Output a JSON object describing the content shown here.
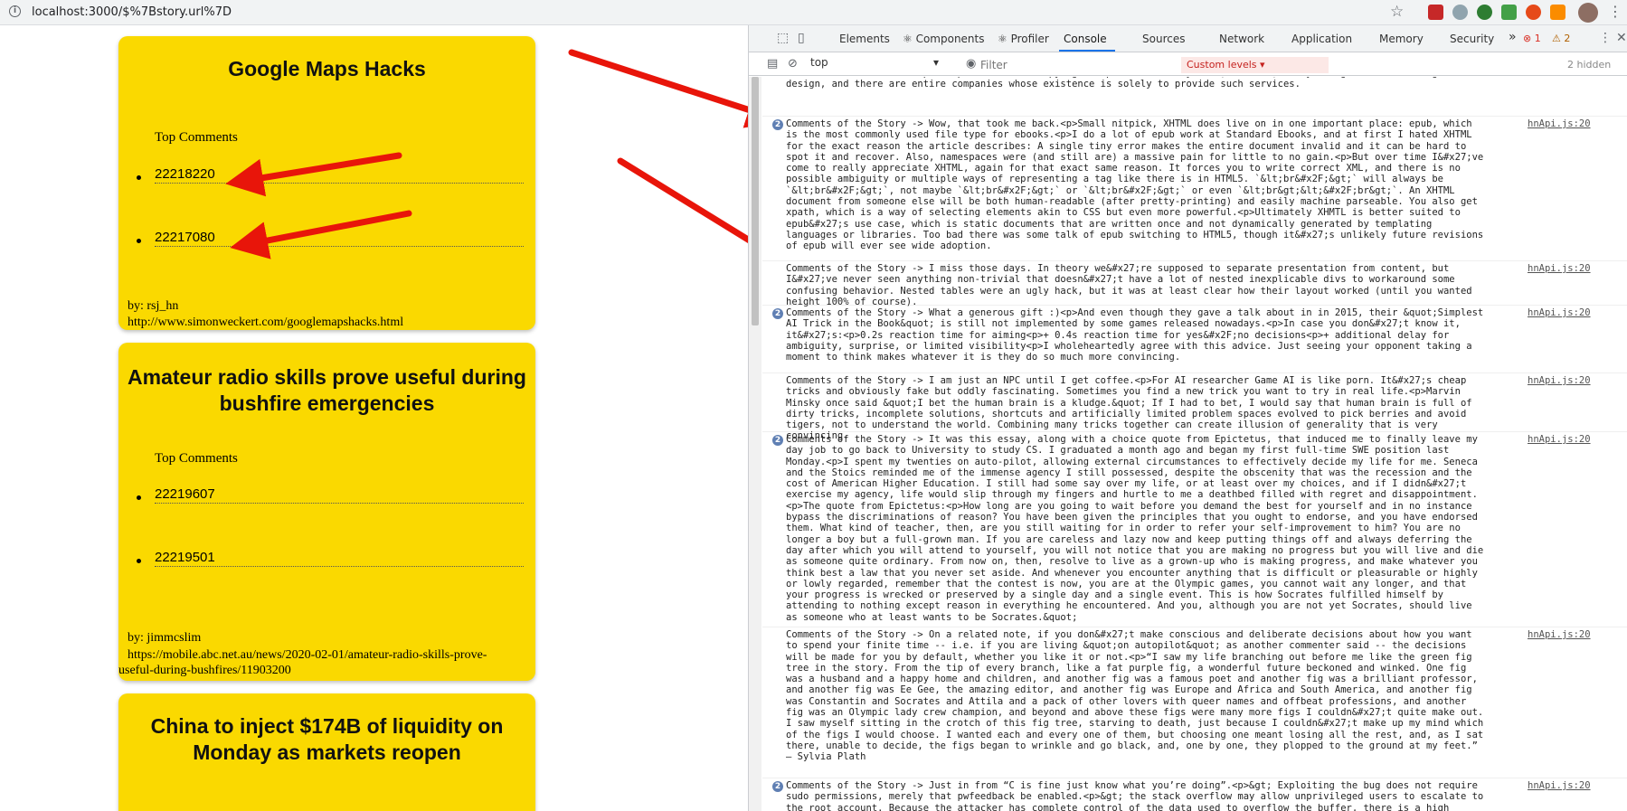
{
  "browser": {
    "url": "localhost:3000/$%7Bstory.url%7D"
  },
  "stories": [
    {
      "title": "Google Maps Hacks",
      "top_comments_label": "Top Comments",
      "comment_ids": [
        "22218220",
        "22217080"
      ],
      "by": "by: rsj_hn",
      "url": "http://www.simonweckert.com/googlemapshacks.html"
    },
    {
      "title": "Amateur radio skills prove useful during bushfire emergencies",
      "top_comments_label": "Top Comments",
      "comment_ids": [
        "22219607",
        "22219501"
      ],
      "by": "by: jimmcslim",
      "url": "https://mobile.abc.net.au/news/2020-02-01/amateur-radio-skills-prove-useful-during-bushfires/11903200"
    },
    {
      "title": "China to inject $174B of liquidity on Monday as markets reopen"
    }
  ],
  "devtools": {
    "tabs": [
      "Elements",
      "Components",
      "Profiler",
      "Console",
      "Sources",
      "Network",
      "Application",
      "Memory",
      "Security"
    ],
    "more_tabs": "»",
    "error_count": "1",
    "warning_count": "2",
    "context": "top",
    "filter_placeholder": "Filter",
    "levels_label": "Custom levels",
    "hidden_label": "2 hidden",
    "messages": [
      {
        "badge": "",
        "source": "",
        "text": "idea that it somehow stops competitors from copying the product is very weak; it&#x27;s easy enough to reverse-engineer a design, and there are entire companies whose existence is solely to provide such services."
      },
      {
        "badge": "2",
        "source": "hnApi.js:20",
        "text": "Comments of the Story ->  Wow, that took me back.<p>Small nitpick, XHTML does live on in one important place: epub, which is the most commonly used file type for ebooks.<p>I do a lot of epub work at Standard Ebooks, and at first I hated XHTML for the exact reason the article describes: A single tiny error makes the entire document invalid and it can be hard to spot it and recover. Also, namespaces were (and still are) a massive pain for little to no gain.<p>But over time I&#x27;ve come to really appreciate XHTML, again for that exact same reason. It forces you to write correct XML, and there is no possible ambiguity or multiple ways of representing a tag like there is in HTML5. `&lt;br&#x2F;&gt;` will always be `&lt;br&#x2F;&gt;`, not maybe `&lt;br&#x2F;&gt;` or `&lt;br&#x2F;&gt;` or even `&lt;br&gt;&lt;&#x2F;br&gt;`. An XHTML document from someone else will be both human-readable (after pretty-printing) and easily machine parseable. You also get xpath, which is a way of selecting elements akin to CSS but even more powerful.<p>Ultimately XHMTL is better suited to epub&#x27;s use case, which is static documents that are written once and not dynamically generated by templating languages or libraries. Too bad there was some talk of epub switching to HTML5, though it&#x27;s unlikely future revisions of epub will ever see wide adoption."
      },
      {
        "badge": "",
        "source": "hnApi.js:20",
        "text": "Comments of the Story ->  I miss those days.  In theory we&#x27;re supposed to separate presentation from content, but I&#x27;ve never seen anything non-trivial that doesn&#x27;t have a lot of nested inexplicable divs to workaround some confusing behavior. Nested tables were an ugly hack, but it was at least clear how their layout worked (until you wanted height 100% of course)."
      },
      {
        "badge": "2",
        "source": "hnApi.js:20",
        "text": "Comments of the Story ->  What a generous gift :)<p>And even though they gave a talk about in in 2015, their &quot;Simplest AI Trick in the Book&quot; is still not implemented by some games released nowadays.<p>In case you don&#x27;t know it, it&#x27;s:<p>0.2s reaction time for aiming<p>+ 0.4s reaction time for yes&#x2F;no decisions<p>+ additional delay for ambiguity, surprise, or limited visibility<p>I wholeheartedly agree with this advice. Just seeing your opponent taking a moment to think makes whatever it is they do so much more convincing."
      },
      {
        "badge": "",
        "source": "hnApi.js:20",
        "text": "Comments of the Story ->  I am just an NPC until I get coffee.<p>For AI researcher Game AI is like  porn. It&#x27;s cheap tricks and obviously fake but oddly fascinating. Sometimes you find a new trick you want to try in real life.<p>Marvin Minsky once said &quot;I bet the human brain is a kludge.&quot; If I had to bet, I would say that human brain is full of dirty tricks, incomplete solutions,  shortcuts and artificially limited problem spaces evolved to pick berries and avoid tigers, not to understand the world. Combining many tricks together can create illusion of generality that is very convincing."
      },
      {
        "badge": "2",
        "source": "hnApi.js:20",
        "text": "Comments of the Story ->  It was this essay, along with a choice quote from Epictetus, that induced me to finally leave my day job to go back to University to study CS. I graduated a month ago and began my first full-time SWE position last Monday.<p>I spent my twenties on auto-pilot, allowing external circumstances to effectively decide my life for me. Seneca and the Stoics reminded me of the immense agency I still possessed, despite the obscenity that was the recession and the cost of American Higher Education. I still had some say over my life, or at least over my choices, and if I didn&#x27;t exercise my agency, life would slip through my fingers and hurtle to me a deathbed filled with regret and disappointment.<p>The quote from Epictetus:<p>How long are you going to wait before you demand the best for yourself and in no instance bypass the discriminations of reason? You have been given the principles that you ought to endorse, and you have endorsed them. What kind of teacher, then, are you still waiting for in order to refer your self-improvement to him? You are no longer a boy but a full-grown man. If you are careless and lazy now and keep putting things off and always deferring the day after which you will attend to yourself, you will not notice that you are making no progress but you will live and die as someone quite ordinary. From now on, then, resolve to live as a grown-up who is making progress, and make whatever you think best a law that you never set aside. And whenever you encounter anything that is difficult or pleasurable or highly or lowly regarded, remember that the contest is now, you are at the Olympic games, you cannot wait any longer, and that your progress is wrecked or preserved by a single day and a single event. This is how Socrates fulfilled himself by attending to nothing except reason in everything he encountered. And you, although you are not yet Socrates, should live as someone who at least wants to be Socrates.&quot;"
      },
      {
        "badge": "",
        "source": "hnApi.js:20",
        "text": "Comments of the Story ->  On a related note, if you don&#x27;t make conscious and deliberate decisions about how you want to spend your finite time -- i.e. if you are living &quot;on autopilot&quot; as another commenter said -- the decisions will be made for you by default, whether you like it or not.<p>“I saw my life branching out before me like the green fig tree in the story. From the tip of every branch, like a fat purple fig, a wonderful future beckoned and winked. One fig was a husband and a happy home and children, and another fig was a famous poet and another fig was a brilliant professor, and another fig was Ee Gee, the amazing editor, and another fig was Europe and Africa and South America, and another fig was Constantin and Socrates and Attila and a pack of other lovers with queer names and offbeat professions, and another fig was an Olympic lady crew champion, and beyond and above these figs were many more figs I couldn&#x27;t quite make out. I saw myself sitting in the crotch of this fig tree, starving to death, just because I couldn&#x27;t make up my mind which of the figs I would choose. I wanted each and every one of them, but choosing one meant losing all the rest, and, as I sat there, unable to decide, the figs began to wrinkle and go black, and, one by one, they plopped to the ground at my feet.” ― Sylvia Plath"
      },
      {
        "badge": "2",
        "source": "hnApi.js:20",
        "text": "Comments of the Story ->  Just in from “C is fine just know what you’re doing”.<p>&gt; Exploiting the bug does not require sudo permissions, merely that pwfeedback be enabled.<p>&gt; the stack overflow may allow unprivileged users to escalate to the root account. Because the attacker has complete control of the data used to overflow the buffer, there is a high likelihood of"
      }
    ]
  },
  "colors": {
    "card_bg": "#fad900",
    "arrow_red": "#e8150a",
    "devtools_tab_accent": "#1a73e8"
  }
}
